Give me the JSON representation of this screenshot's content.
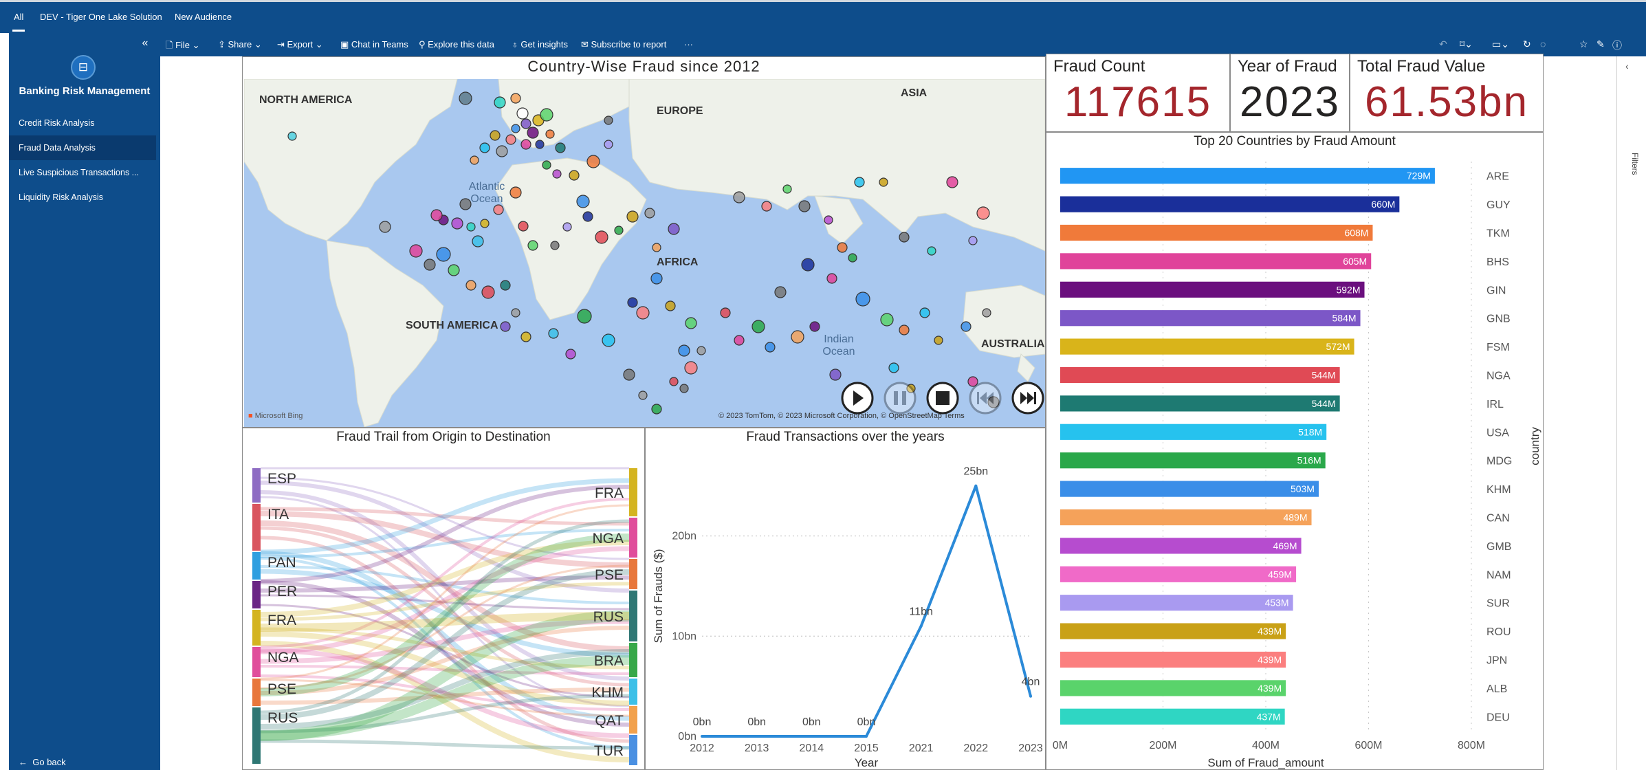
{
  "topbar": {
    "all": "All",
    "workspace": "DEV - Tiger One Lake Solution",
    "audience": "New Audience"
  },
  "sidebar": {
    "title": "Banking Risk Management",
    "items": [
      {
        "label": "Credit Risk Analysis",
        "active": false
      },
      {
        "label": "Fraud Data Analysis",
        "active": true
      },
      {
        "label": "Live Suspicious Transactions ...",
        "active": false
      },
      {
        "label": "Liquidity Risk Analysis",
        "active": false
      }
    ],
    "go_back": "Go back"
  },
  "toolbar": {
    "file": "File",
    "share": "Share",
    "export": "Export",
    "chat": "Chat in Teams",
    "explore": "Explore this data",
    "insights": "Get insights",
    "subscribe": "Subscribe to report",
    "more": "···",
    "icons": [
      "undo-icon",
      "bookmark-icon",
      "view-icon",
      "refresh-icon",
      "comment-icon",
      "favorite-icon",
      "edit-icon",
      "info-icon"
    ]
  },
  "filters_pane": {
    "label": "Filters"
  },
  "map": {
    "title": "Country-Wise Fraud since 2012",
    "labels": {
      "north_america": "NORTH AMERICA",
      "south_america": "SOUTH AMERICA",
      "europe": "EUROPE",
      "asia": "ASIA",
      "africa": "AFRICA",
      "australia": "AUSTRALIA",
      "atlantic": "Atlantic Ocean",
      "indian": "Indian Ocean"
    },
    "bing": "Microsoft Bing",
    "copyright": "© 2023 TomTom, © 2023 Microsoft Corporation, © OpenStreetMap Terms",
    "controls": [
      "play-icon",
      "pause-icon",
      "stop-icon",
      "rewind-icon",
      "fast-forward-icon"
    ]
  },
  "kpis": {
    "count": {
      "title": "Fraud Count",
      "value": "117615",
      "color": "#a4262c"
    },
    "year": {
      "title": "Year of Fraud",
      "value": "2023",
      "color": "#252423"
    },
    "total": {
      "title": "Total Fraud Value",
      "value": "61.53bn",
      "color": "#a4262c"
    }
  },
  "sankey": {
    "title": "Fraud Trail from Origin to Destination",
    "origins": [
      {
        "label": "ESP",
        "color": "#8e6cc3"
      },
      {
        "label": "ITA",
        "color": "#d9555f"
      },
      {
        "label": "PAN",
        "color": "#2f9fe0"
      },
      {
        "label": "PER",
        "color": "#6b2585"
      },
      {
        "label": "FRA",
        "color": "#d4b420"
      },
      {
        "label": "NGA",
        "color": "#e04e9b"
      },
      {
        "label": "PSE",
        "color": "#e8773c"
      },
      {
        "label": "RUS",
        "color": "#2f7774"
      }
    ],
    "destinations": [
      {
        "label": "FRA",
        "color": "#d4b420"
      },
      {
        "label": "NGA",
        "color": "#e04e9b"
      },
      {
        "label": "PSE",
        "color": "#e8773c"
      },
      {
        "label": "RUS",
        "color": "#2f7774"
      },
      {
        "label": "BRA",
        "color": "#37a849"
      },
      {
        "label": "KHM",
        "color": "#3cc0e8"
      },
      {
        "label": "QAT",
        "color": "#f2a14c"
      },
      {
        "label": "TUR",
        "color": "#4a90e2"
      }
    ]
  },
  "chart_data": [
    {
      "type": "line",
      "title": "Fraud Transactions over the years",
      "xlabel": "Year",
      "ylabel": "Sum of Frauds ($)",
      "x": [
        "2012",
        "2013",
        "2014",
        "2015",
        "2021",
        "2022",
        "2023"
      ],
      "values": [
        0,
        0,
        0,
        0,
        11,
        25,
        4
      ],
      "data_labels": [
        "0bn",
        "0bn",
        "0bn",
        "0bn",
        "11bn",
        "25bn",
        "4bn"
      ],
      "yticks": [
        0,
        10,
        20
      ],
      "ytick_labels": [
        "0bn",
        "10bn",
        "20bn"
      ],
      "ylim": [
        0,
        28
      ],
      "color": "#2b8ad8"
    },
    {
      "type": "bar",
      "orientation": "horizontal",
      "title": "Top 20 Countries by Fraud Amount",
      "xlabel": "Sum of Fraud_amount",
      "ylabel": "country",
      "categories": [
        "ARE",
        "GUY",
        "TKM",
        "BHS",
        "GIN",
        "GNB",
        "FSM",
        "NGA",
        "IRL",
        "USA",
        "MDG",
        "KHM",
        "CAN",
        "GMB",
        "NAM",
        "SUR",
        "ROU",
        "JPN",
        "ALB",
        "DEU"
      ],
      "values": [
        729,
        660,
        608,
        605,
        592,
        584,
        572,
        544,
        544,
        518,
        516,
        503,
        489,
        469,
        459,
        453,
        439,
        439,
        439,
        437
      ],
      "data_labels": [
        "729M",
        "660M",
        "608M",
        "605M",
        "592M",
        "584M",
        "572M",
        "544M",
        "544M",
        "518M",
        "516M",
        "503M",
        "489M",
        "469M",
        "459M",
        "453M",
        "439M",
        "439M",
        "439M",
        "437M"
      ],
      "colors": [
        "#2196f3",
        "#1a2f9a",
        "#f07a3a",
        "#e0439a",
        "#6b0f7e",
        "#7c57c7",
        "#d9b41a",
        "#e04a55",
        "#1e7a72",
        "#26c2ee",
        "#2aa84a",
        "#3a8ee8",
        "#f5a25a",
        "#b64ccf",
        "#f06ac8",
        "#a99af0",
        "#c9a117",
        "#fb7f7f",
        "#5ad36b",
        "#2fd6c3"
      ],
      "xticks": [
        0,
        200,
        400,
        600,
        800
      ],
      "xtick_labels": [
        "0M",
        "200M",
        "400M",
        "600M",
        "800M"
      ],
      "xlim": [
        0,
        800
      ]
    }
  ]
}
